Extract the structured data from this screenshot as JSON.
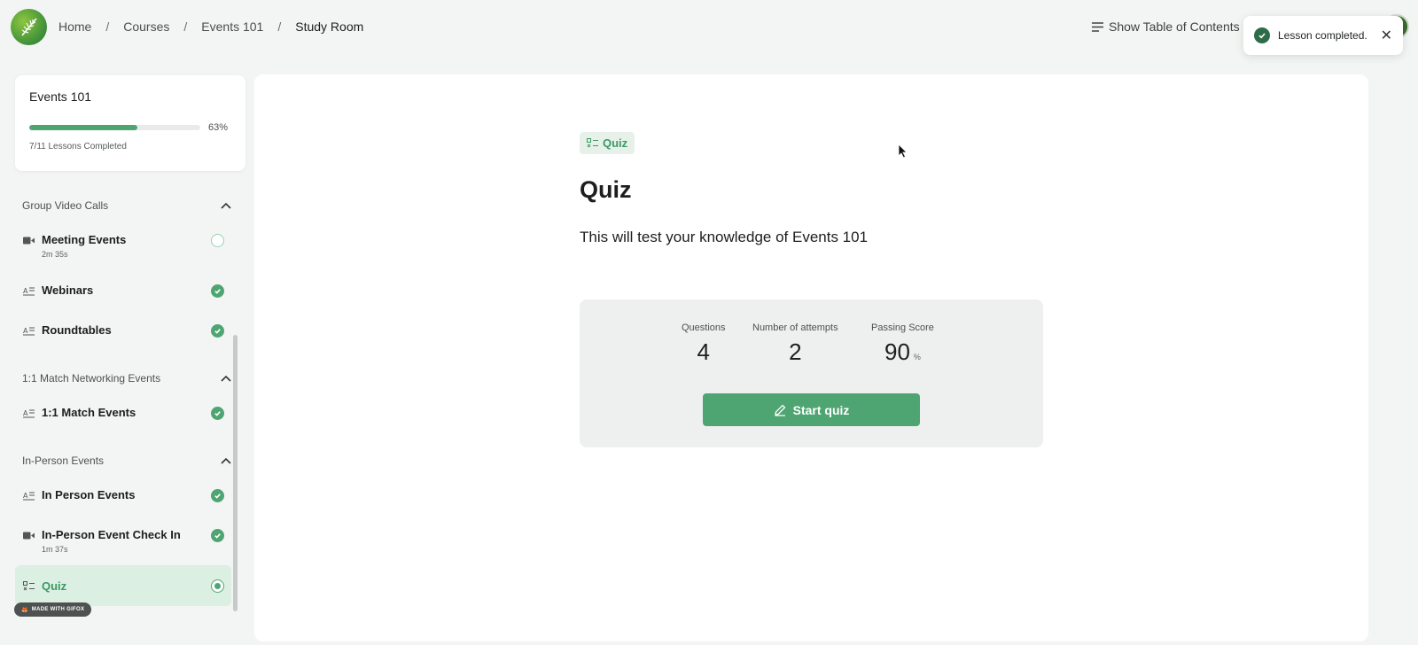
{
  "breadcrumb": [
    "Home",
    "Courses",
    "Events 101",
    "Study Room"
  ],
  "header": {
    "toc_label": "Show Table of Contents"
  },
  "toast": {
    "message": "Lesson completed."
  },
  "progress": {
    "course_title": "Events 101",
    "percent_label": "63%",
    "percent": 0.63,
    "lessons_completed": "7/11 Lessons Completed"
  },
  "sections": [
    {
      "title": "Group Video Calls"
    },
    {
      "title": "1:1 Match Networking Events"
    },
    {
      "title": "In-Person Events"
    }
  ],
  "lessons": [
    {
      "name": "Meeting Events",
      "duration": "2m 35s",
      "type": "video-icon",
      "status": "incomplete"
    },
    {
      "name": "Webinars",
      "type": "article-icon",
      "status": "complete"
    },
    {
      "name": "Roundtables",
      "type": "article-icon",
      "status": "complete"
    },
    {
      "name": "1:1 Match Events",
      "type": "article-icon",
      "status": "complete"
    },
    {
      "name": "In Person Events",
      "type": "article-icon",
      "status": "complete"
    },
    {
      "name": "In-Person Event Check In",
      "duration": "1m 37s",
      "type": "video-icon",
      "status": "complete"
    },
    {
      "name": "Quiz",
      "type": "quiz-icon",
      "status": "current"
    }
  ],
  "watermark": "MADE WITH GIFOX",
  "main": {
    "tag": "Quiz",
    "title": "Quiz",
    "description": "This will test your knowledge of Events 101",
    "stats": [
      {
        "label": "Questions",
        "value": "4"
      },
      {
        "label": "Number of attempts",
        "value": "2"
      },
      {
        "label": "Passing Score",
        "value": "90",
        "unit": "%"
      }
    ],
    "start_label": "Start quiz"
  },
  "colors": {
    "accent": "#4ea572",
    "toast_check": "#2e6b48",
    "background": "#f3f5f4"
  }
}
